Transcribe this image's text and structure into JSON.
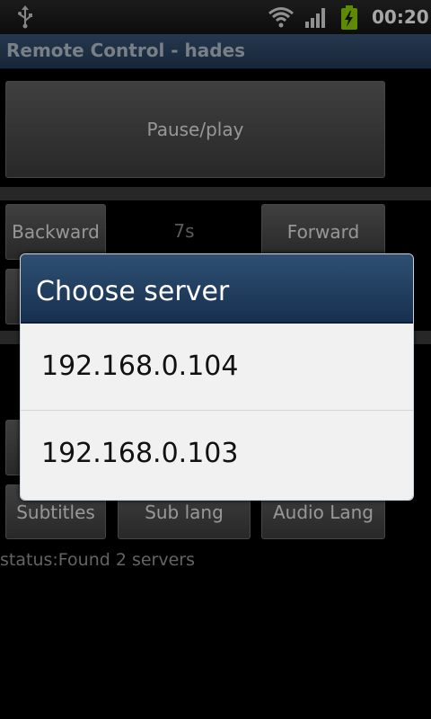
{
  "status_bar": {
    "time": "00:20",
    "icons": [
      "usb-icon",
      "wifi-icon",
      "signal-icon",
      "battery-charging-icon"
    ],
    "battery_color": "#8fd400"
  },
  "app": {
    "title": "Remote Control - hades",
    "title_bar_color": "#2c4968"
  },
  "controls": {
    "pause_play_label": "Pause/play",
    "backward_label": "Backward",
    "step_value": "7s",
    "forward_label": "Forward",
    "subtitles_label": "Subtitles",
    "sub_lang_label": "Sub lang",
    "audio_lang_label": "Audio Lang"
  },
  "status": {
    "text": "status:Found 2 servers"
  },
  "dialog": {
    "title": "Choose server",
    "items": [
      {
        "label": "192.168.0.104"
      },
      {
        "label": "192.168.0.103"
      }
    ]
  }
}
